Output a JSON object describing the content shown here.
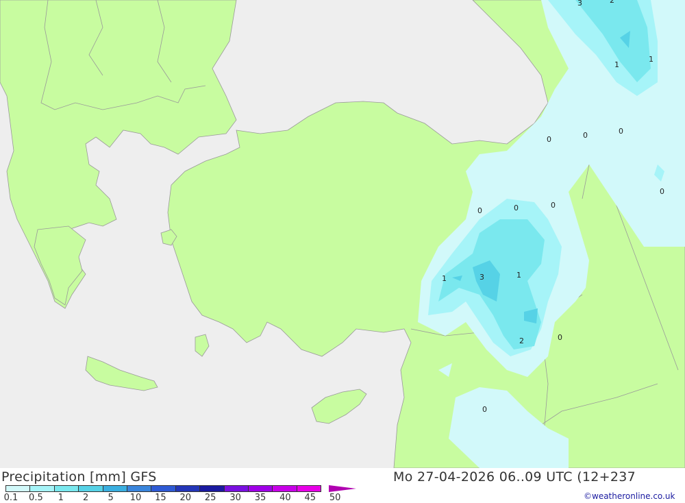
{
  "colors": {
    "sea": "#eeeeee",
    "land": "#c8fca0",
    "border": "#999999",
    "precip_levels": [
      "#d2f9fa",
      "#a6f4f8",
      "#7ae8ee",
      "#56d2e6",
      "#3aafe0",
      "#3a85dc",
      "#2e5ad4",
      "#2436b8",
      "#1a1aa0",
      "#7a10e0",
      "#a000e8",
      "#c800e8",
      "#e800e8",
      "#c800b8",
      "#b000b0"
    ]
  },
  "map_labels": [
    "3",
    "2",
    "1",
    "1",
    "0",
    "0",
    "0",
    "0",
    "0",
    "0",
    "0",
    "1",
    "3",
    "1",
    "2",
    "0",
    "0"
  ],
  "footer": {
    "title_left": "Precipitation [mm] GFS",
    "title_right": "Mo 27-04-2026 06..09 UTC (12+237",
    "credit": "©weatheronline.co.uk",
    "scale_ticks": [
      "0.1",
      "0.5",
      "1",
      "2",
      "5",
      "10",
      "15",
      "20",
      "25",
      "30",
      "35",
      "40",
      "45",
      "50"
    ]
  }
}
